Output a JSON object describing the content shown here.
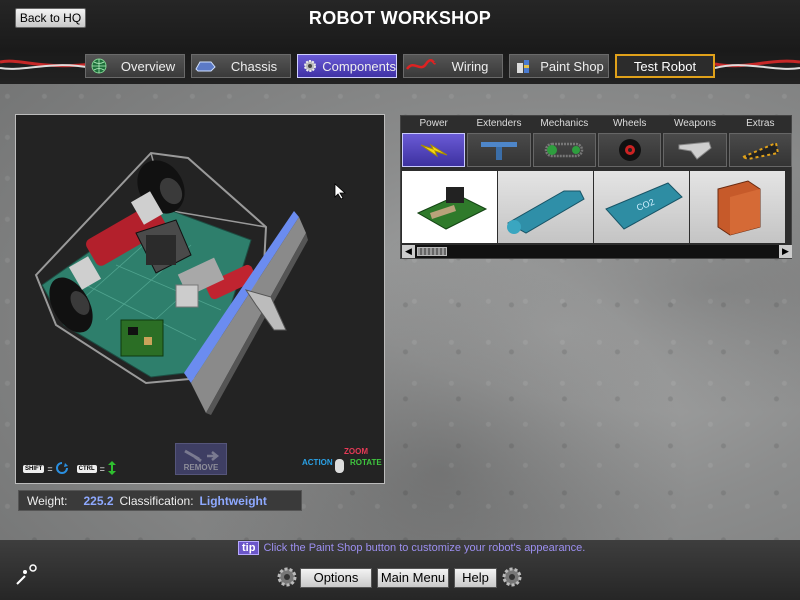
{
  "header": {
    "back_label": "Back to HQ",
    "title": "ROBOT WORKSHOP",
    "tabs": [
      {
        "label": "Overview",
        "icon": "globe-icon",
        "active": false
      },
      {
        "label": "Chassis",
        "icon": "chassis-icon",
        "active": false
      },
      {
        "label": "Components",
        "icon": "gear-icon",
        "active": true
      },
      {
        "label": "Wiring",
        "icon": "wire-icon",
        "active": false
      },
      {
        "label": "Paint Shop",
        "icon": "paint-can-icon",
        "active": false
      },
      {
        "label": "Test Robot",
        "icon": "hazard-stripe",
        "active": false
      }
    ]
  },
  "viewport": {
    "shift_key": "SHIFT",
    "ctrl_key": "CTRL",
    "eq": "=",
    "remove_label": "REMOVE",
    "action_label": "ACTION",
    "zoom_label": "ZOOM",
    "rotate_label": "ROTATE"
  },
  "stats": {
    "weight_label": "Weight:",
    "weight_value": "225.2",
    "class_label": "Classification:",
    "class_value": "Lightweight"
  },
  "picker": {
    "categories": [
      "Power",
      "Extenders",
      "Mechanics",
      "Wheels",
      "Weapons",
      "Extras"
    ],
    "active_category": "Power",
    "items": [
      "circuit-board",
      "gas-tank",
      "co2-tank",
      "battery-box"
    ]
  },
  "footer": {
    "tip_badge": "tip",
    "tip_text": "Click the Paint Shop button to customize your robot's appearance.",
    "options_label": "Options",
    "main_menu_label": "Main Menu",
    "help_label": "Help"
  },
  "colors": {
    "accent": "#5a4bc9",
    "value_text": "#8ea9ff",
    "hazard": "#e0a11a"
  }
}
